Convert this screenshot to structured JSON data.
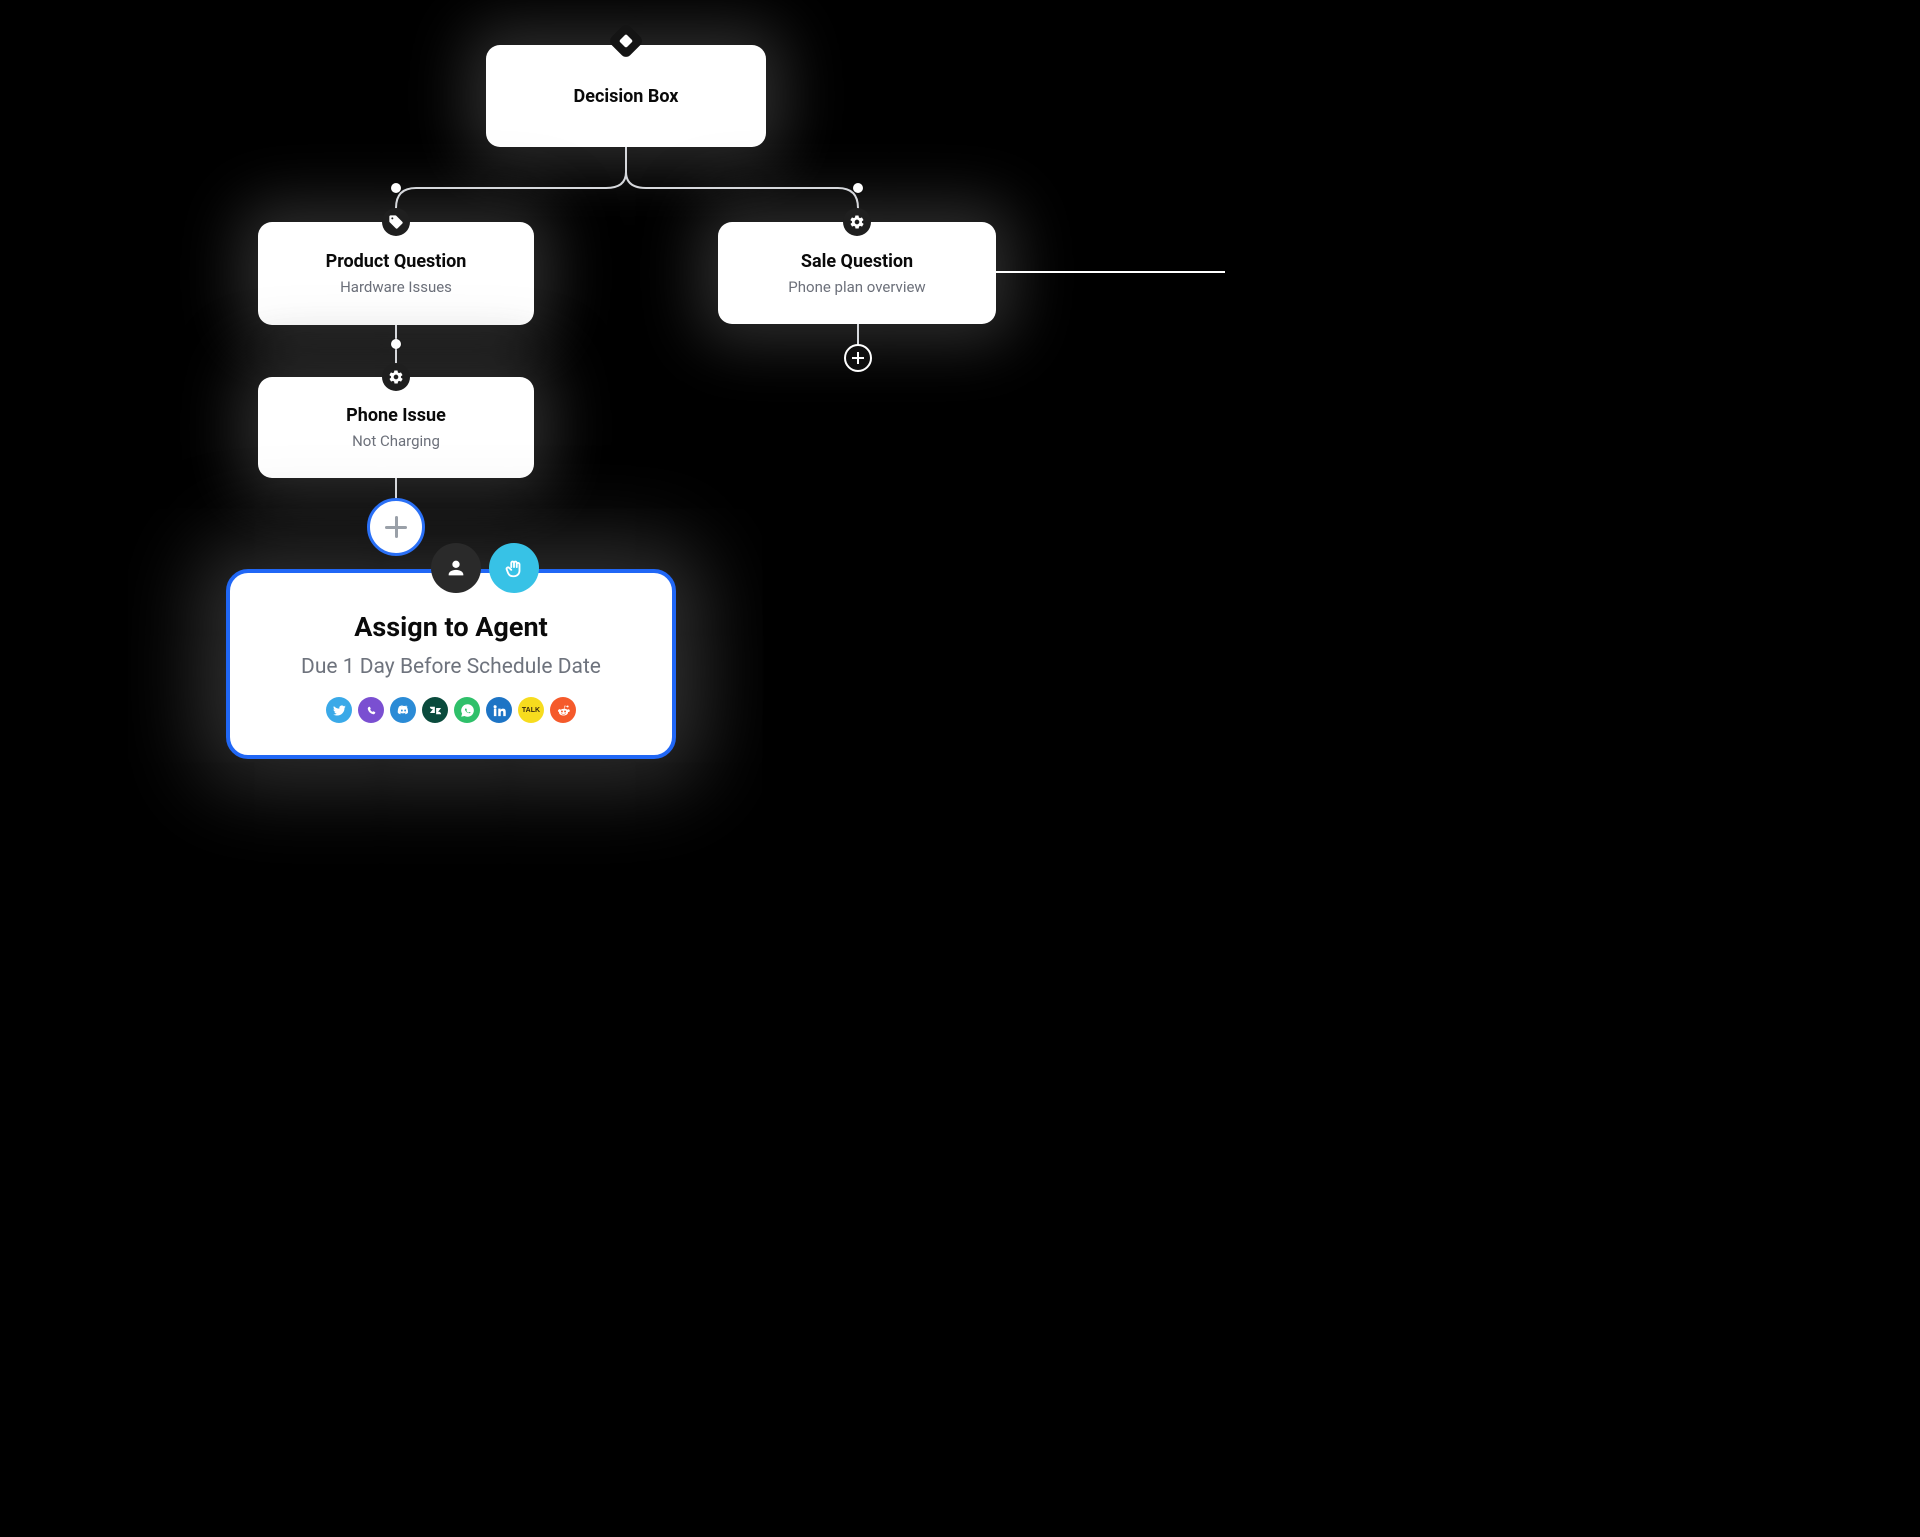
{
  "decision": {
    "title": "Decision Box"
  },
  "product": {
    "title": "Product Question",
    "subtitle": "Hardware Issues"
  },
  "sale": {
    "title": "Sale Question",
    "subtitle": "Phone plan overview"
  },
  "phone": {
    "title": "Phone Issue",
    "subtitle": "Not Charging"
  },
  "assign": {
    "title": "Assign to Agent",
    "subtitle": "Due 1 Day Before Schedule Date"
  },
  "channels": {
    "twitter": {
      "bg": "#3aa9e8"
    },
    "viber": {
      "bg": "#7a4fd1"
    },
    "discord": {
      "bg": "#2b8bd6"
    },
    "zendesk": {
      "bg": "#0a4b3d"
    },
    "whatsapp": {
      "bg": "#2fc06a"
    },
    "linkedin": {
      "bg": "#1d74c5"
    },
    "kakao": {
      "bg": "#f7dc1e",
      "label": "TALK",
      "fg": "#3a2b10"
    },
    "reddit": {
      "bg": "#f55a2b"
    }
  }
}
